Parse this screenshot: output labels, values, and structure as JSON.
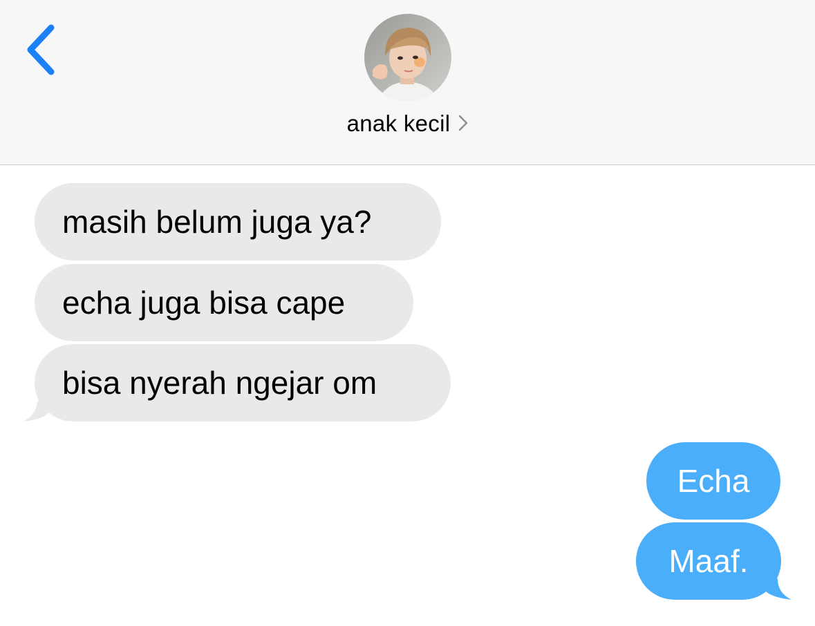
{
  "header": {
    "contact_name": "anak kecil",
    "back_icon": "chevron-left-icon",
    "detail_icon": "chevron-right-icon",
    "avatar": "contact-avatar-photo"
  },
  "messages": [
    {
      "direction": "incoming",
      "text": "masih belum juga ya?"
    },
    {
      "direction": "incoming",
      "text": "echa juga bisa cape"
    },
    {
      "direction": "incoming",
      "text": "bisa nyerah ngejar om"
    },
    {
      "direction": "outgoing",
      "text": "Echa"
    },
    {
      "direction": "outgoing",
      "text": "Maaf."
    }
  ],
  "colors": {
    "accent": "#1a82f6",
    "outgoing_bubble": "#4aaefa",
    "incoming_bubble": "#e9e9eb",
    "header_bg": "#f7f7f8"
  }
}
